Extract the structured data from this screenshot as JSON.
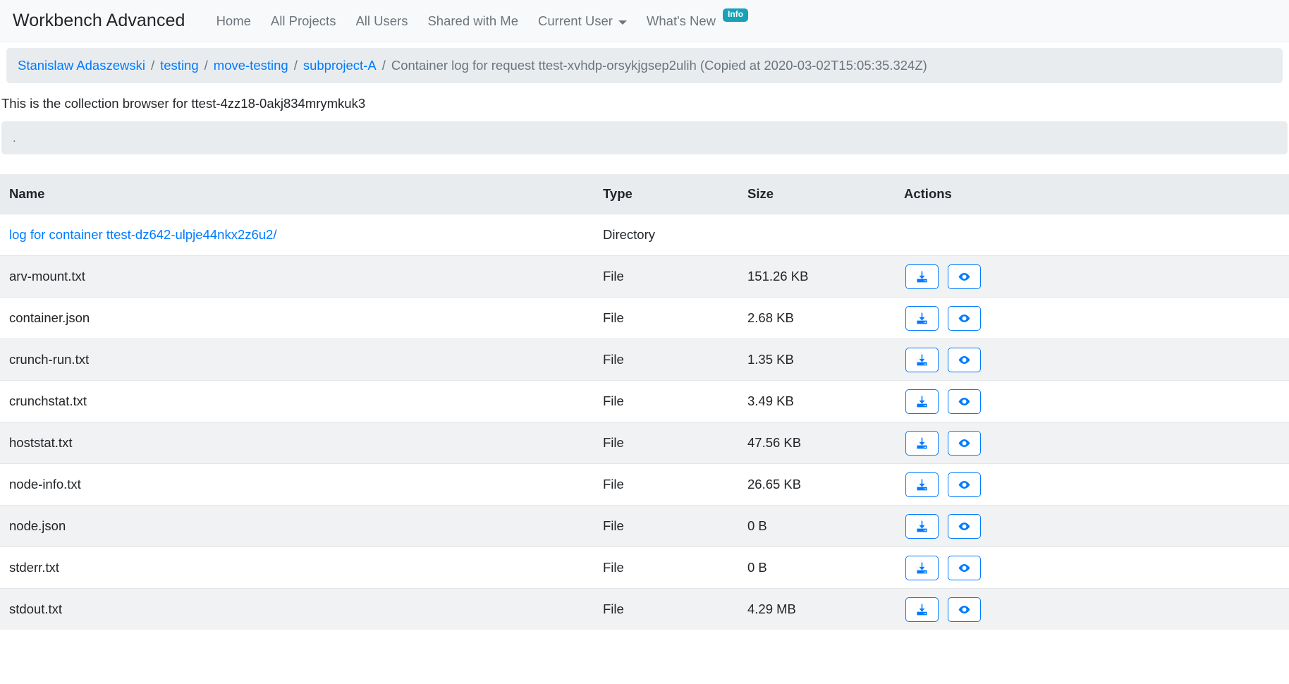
{
  "navbar": {
    "brand": "Workbench Advanced",
    "links": [
      {
        "label": "Home",
        "dropdown": false
      },
      {
        "label": "All Projects",
        "dropdown": false
      },
      {
        "label": "All Users",
        "dropdown": false
      },
      {
        "label": "Shared with Me",
        "dropdown": false
      },
      {
        "label": "Current User",
        "dropdown": true
      },
      {
        "label": "What's New",
        "dropdown": false,
        "badge": "Info"
      }
    ],
    "badge_color": "#17a2b8"
  },
  "breadcrumb": {
    "items": [
      {
        "label": "Stanislaw Adaszewski",
        "link": true
      },
      {
        "label": "testing",
        "link": true
      },
      {
        "label": "move-testing",
        "link": true
      },
      {
        "label": "subproject-A",
        "link": true
      },
      {
        "label": "Container log for request ttest-xvhdp-orsykjgsep2ulih (Copied at 2020-03-02T15:05:35.324Z)",
        "link": false
      }
    ],
    "separator": "/",
    "link_color": "#007bff"
  },
  "intro": {
    "text": "This is the collection browser for ttest-4zz18-0akj834mrymkuk3"
  },
  "path_bar": {
    "label": "."
  },
  "table": {
    "headers": [
      "Name",
      "Type",
      "Size",
      "Actions"
    ],
    "rows": [
      {
        "name": "log for container ttest-dz642-ulpje44nkx2z6u2/",
        "is_link": true,
        "type": "Directory",
        "size": "",
        "actions": []
      },
      {
        "name": "arv-mount.txt",
        "is_link": false,
        "type": "File",
        "size": "151.26 KB",
        "actions": [
          "download-icon",
          "eye-icon"
        ]
      },
      {
        "name": "container.json",
        "is_link": false,
        "type": "File",
        "size": "2.68 KB",
        "actions": [
          "download-icon",
          "eye-icon"
        ]
      },
      {
        "name": "crunch-run.txt",
        "is_link": false,
        "type": "File",
        "size": "1.35 KB",
        "actions": [
          "download-icon",
          "eye-icon"
        ]
      },
      {
        "name": "crunchstat.txt",
        "is_link": false,
        "type": "File",
        "size": "3.49 KB",
        "actions": [
          "download-icon",
          "eye-icon"
        ]
      },
      {
        "name": "hoststat.txt",
        "is_link": false,
        "type": "File",
        "size": "47.56 KB",
        "actions": [
          "download-icon",
          "eye-icon"
        ]
      },
      {
        "name": "node-info.txt",
        "is_link": false,
        "type": "File",
        "size": "26.65 KB",
        "actions": [
          "download-icon",
          "eye-icon"
        ]
      },
      {
        "name": "node.json",
        "is_link": false,
        "type": "File",
        "size": "0 B",
        "actions": [
          "download-icon",
          "eye-icon"
        ]
      },
      {
        "name": "stderr.txt",
        "is_link": false,
        "type": "File",
        "size": "0 B",
        "actions": [
          "download-icon",
          "eye-icon"
        ]
      },
      {
        "name": "stdout.txt",
        "is_link": false,
        "type": "File",
        "size": "4.29 MB",
        "actions": [
          "download-icon",
          "eye-icon"
        ]
      }
    ],
    "accent_color": "#007bff",
    "header_bg": "#e9ecef"
  }
}
